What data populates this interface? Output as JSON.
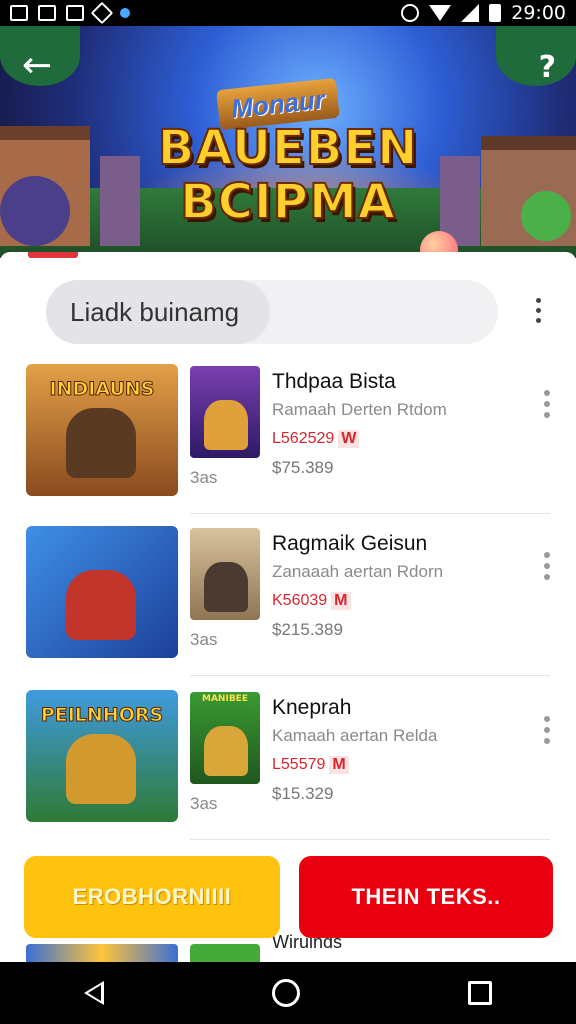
{
  "status_bar": {
    "time": "29:00",
    "icons": [
      "x-icon",
      "image-icon",
      "bookmark-icon",
      "tag-icon",
      "dot-icon",
      "alarm-icon",
      "wifi-icon",
      "signal-icon",
      "battery-icon"
    ]
  },
  "hero": {
    "badge": "Monaur",
    "title_line1": "BAUEBEN",
    "title_line2": "BCIPMA",
    "back_icon": "back-arrow-icon",
    "help_icon": "help-icon",
    "back_glyph": "←",
    "help_glyph": "?"
  },
  "search": {
    "chip_text": "Liadk buinamg"
  },
  "items": [
    {
      "thumb_label": "INDIAUNS",
      "thumb_small_caption": "",
      "meta_small": "3as",
      "name": "Thdpaa Bista",
      "sub": "Ramaah Derten Rtdom",
      "code": "L562529",
      "code_badge": "W",
      "price": "$75.389",
      "colors": {
        "bg": "#c7772c",
        "fig": "#5a3a22",
        "small_bg": "#7a3fb0",
        "small_fig": "#e0a03a"
      }
    },
    {
      "thumb_label": "",
      "thumb_small_caption": "",
      "meta_small": "3as",
      "name": "Ragmaik Geisun",
      "sub": "Zanaaah aertan Rdorn",
      "code": "K56039",
      "code_badge": "M",
      "price": "$215.389",
      "colors": {
        "bg": "#2f74d0",
        "fig": "#c2352a",
        "small_bg": "#c9b08a",
        "small_fig": "#4a3a32"
      }
    },
    {
      "thumb_label": "PEILNHORS",
      "thumb_small_caption": "MANIBEE",
      "meta_small": "3as",
      "name": "Kneprah",
      "sub": "Kamaah aertan Relda",
      "code": "L55579",
      "code_badge": "M",
      "price": "$15.329",
      "colors": {
        "bg": "#3a8a3e",
        "fig": "#d29a2e",
        "small_bg": "#3a9a32",
        "small_fig": "#d9a63a"
      }
    }
  ],
  "buttons": {
    "primary": "EROBHORNIIII",
    "secondary": "THEIN TEKS.."
  },
  "peek_text": "Wiruinds",
  "nav": {
    "back_icon": "nav-back-icon",
    "home_icon": "nav-home-icon",
    "recents_icon": "nav-recents-icon"
  }
}
